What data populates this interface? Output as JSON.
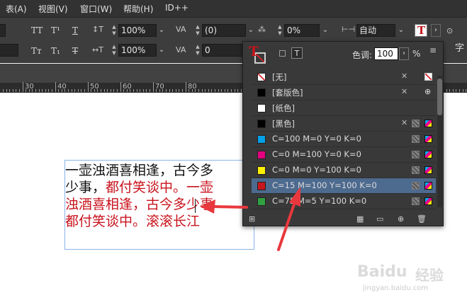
{
  "menu": [
    "表(A)",
    "视图(V)",
    "窗口(W)",
    "帮助(H)",
    "ID++"
  ],
  "control": {
    "row1": {
      "tracking_value": "100%",
      "kerning_value": "(0)",
      "baseline_shift_value": "0%",
      "composer_value": "自动"
    },
    "row2": {
      "horizontal_scale_value": "100%",
      "tracking_value": "0"
    },
    "glyphs": {
      "tt_caps": "TT",
      "tt_super": "T¹",
      "t_under": "T",
      "tt_small": "Tт",
      "t_sub": "T₁",
      "t_strike": "T"
    },
    "overflow_char": "字"
  },
  "ruler": {
    "labels": [
      "30",
      "40",
      "50",
      "60",
      "70",
      "80"
    ]
  },
  "text_frame": {
    "lines": [
      [
        {
          "text": "一壶浊酒喜相逢，古今多",
          "color": "black"
        }
      ],
      [
        {
          "text": "少事，",
          "color": "black"
        },
        {
          "text": "都付笑谈中。一壶",
          "color": "red"
        }
      ],
      [
        {
          "text": "浊酒喜相逢，古今多少事",
          "color": "red"
        }
      ],
      [
        {
          "text": "都付笑谈中。滚滚长江",
          "color": "red"
        }
      ]
    ]
  },
  "swatches_panel": {
    "tint_label": "色调:",
    "tint_value": "100",
    "tint_unit": "%",
    "swatches": [
      {
        "name": "[无]",
        "color": "none",
        "selected": false
      },
      {
        "name": "[套版色]",
        "color": "#000000",
        "selected": false
      },
      {
        "name": "[纸色]",
        "color": "#ffffff",
        "selected": false
      },
      {
        "name": "[黑色]",
        "color": "#000000",
        "selected": false
      },
      {
        "name": "C=100 M=0 Y=0 K=0",
        "color": "#00a0e9",
        "selected": false
      },
      {
        "name": "C=0 M=100 Y=0 K=0",
        "color": "#e4007f",
        "selected": false
      },
      {
        "name": "C=0 M=0 Y=100 K=0",
        "color": "#fff100",
        "selected": false
      },
      {
        "name": "C=15 M=100 Y=100 K=0",
        "color": "#c8161d",
        "selected": true
      },
      {
        "name": "C=75 M=5 Y=100 K=0",
        "color": "#2fa142",
        "selected": false
      }
    ]
  },
  "colors": {
    "annotation_arrow": "#e8383d",
    "selected_row": "#4d6a8f",
    "frame_border": "#8ab4e6"
  },
  "watermark": {
    "brand": "Baidu",
    "brand_cn": "经验",
    "url": "jingyan.baidu.com"
  }
}
